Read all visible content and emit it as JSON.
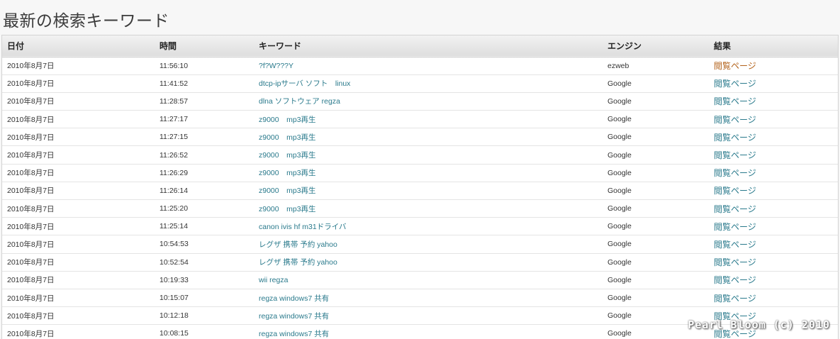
{
  "page_title": "最新の検索キーワード",
  "table": {
    "headers": {
      "date": "日付",
      "time": "時間",
      "keyword": "キーワード",
      "engine": "エンジン",
      "result": "結果"
    },
    "rows": [
      {
        "date": "2010年8月7日",
        "time": "11:56:10",
        "keyword": "?f?W???Y",
        "engine": "ezweb",
        "result": "閲覧ページ"
      },
      {
        "date": "2010年8月7日",
        "time": "11:41:52",
        "keyword": "dtcp-ipサーバ ソフト　linux",
        "engine": "Google",
        "result": "閲覧ページ"
      },
      {
        "date": "2010年8月7日",
        "time": "11:28:57",
        "keyword": "dlna ソフトウェア regza",
        "engine": "Google",
        "result": "閲覧ページ"
      },
      {
        "date": "2010年8月7日",
        "time": "11:27:17",
        "keyword": "z9000　mp3再生",
        "engine": "Google",
        "result": "閲覧ページ"
      },
      {
        "date": "2010年8月7日",
        "time": "11:27:15",
        "keyword": "z9000　mp3再生",
        "engine": "Google",
        "result": "閲覧ページ"
      },
      {
        "date": "2010年8月7日",
        "time": "11:26:52",
        "keyword": "z9000　mp3再生",
        "engine": "Google",
        "result": "閲覧ページ"
      },
      {
        "date": "2010年8月7日",
        "time": "11:26:29",
        "keyword": "z9000　mp3再生",
        "engine": "Google",
        "result": "閲覧ページ"
      },
      {
        "date": "2010年8月7日",
        "time": "11:26:14",
        "keyword": "z9000　mp3再生",
        "engine": "Google",
        "result": "閲覧ページ"
      },
      {
        "date": "2010年8月7日",
        "time": "11:25:20",
        "keyword": "z9000　mp3再生",
        "engine": "Google",
        "result": "閲覧ページ"
      },
      {
        "date": "2010年8月7日",
        "time": "11:25:14",
        "keyword": "canon ivis hf m31ドライバ",
        "engine": "Google",
        "result": "閲覧ページ"
      },
      {
        "date": "2010年8月7日",
        "time": "10:54:53",
        "keyword": "レグザ 携帯 予約 yahoo",
        "engine": "Google",
        "result": "閲覧ページ"
      },
      {
        "date": "2010年8月7日",
        "time": "10:52:54",
        "keyword": "レグザ 携帯 予約 yahoo",
        "engine": "Google",
        "result": "閲覧ページ"
      },
      {
        "date": "2010年8月7日",
        "time": "10:19:33",
        "keyword": "wii regza",
        "engine": "Google",
        "result": "閲覧ページ"
      },
      {
        "date": "2010年8月7日",
        "time": "10:15:07",
        "keyword": "regza windows7 共有",
        "engine": "Google",
        "result": "閲覧ページ"
      },
      {
        "date": "2010年8月7日",
        "time": "10:12:18",
        "keyword": "regza windows7 共有",
        "engine": "Google",
        "result": "閲覧ページ"
      },
      {
        "date": "2010年8月7日",
        "time": "10:08:15",
        "keyword": "regza windows7 共有",
        "engine": "Google",
        "result": "閲覧ページ"
      }
    ]
  },
  "watermark": "Pearl Bloom (c) 2010",
  "colors": {
    "link": "#2a7a8c",
    "visited_link": "#b3621a",
    "header_bg": "#e6e6e6"
  }
}
